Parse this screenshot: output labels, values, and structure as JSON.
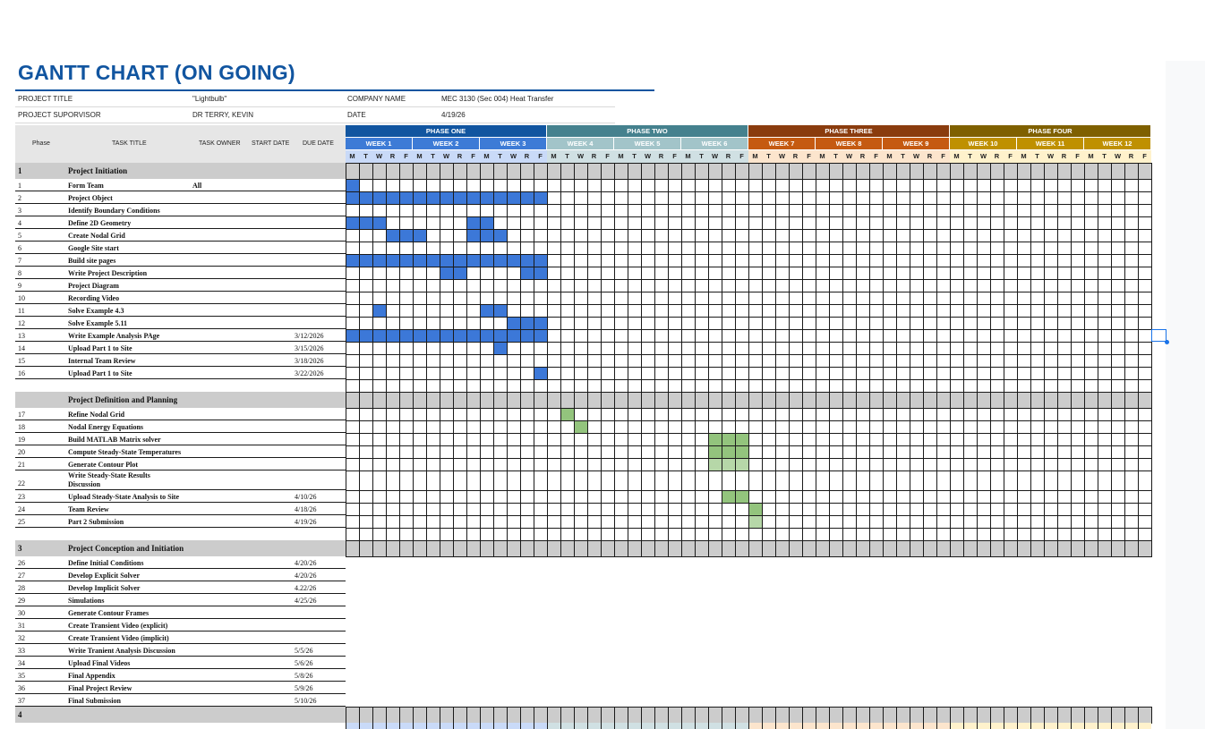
{
  "title": "GANTT CHART (ON GOING)",
  "info": {
    "project_title_label": "PROJECT TITLE",
    "project_title_value": "\"Lightbulb\"",
    "company_label": "COMPANY NAME",
    "company_value": "MEC 3130 (Sec 004) Heat Transfer",
    "supervisor_label": "PROJECT SUPORVISOR",
    "supervisor_value": "DR TERRY, KEVIN",
    "date_label": "DATE",
    "date_value": "4/19/26"
  },
  "columns": {
    "phase": "Phase",
    "task_title": "TASK TITLE",
    "task_owner": "TASK OWNER",
    "start_date": "START DATE",
    "due_date": "DUE DATE"
  },
  "phases": [
    {
      "name": "PHASE ONE",
      "color": "#1155a0",
      "light": "#c9daf8"
    },
    {
      "name": "PHASE TWO",
      "color": "#45818e",
      "light": "#d0e0e3"
    },
    {
      "name": "PHASE THREE",
      "color": "#8a3c0e",
      "light": "#fce5cd"
    },
    {
      "name": "PHASE FOUR",
      "color": "#7f6000",
      "light": "#fff2cc"
    }
  ],
  "weeks": [
    {
      "label": "WEEK 1",
      "color": "#3d7bd6"
    },
    {
      "label": "WEEK 2",
      "color": "#3d7bd6"
    },
    {
      "label": "WEEK 3",
      "color": "#3d7bd6"
    },
    {
      "label": "WEEK 4",
      "color": "#a2c4c9"
    },
    {
      "label": "WEEK 5",
      "color": "#a2c4c9"
    },
    {
      "label": "WEEK 6",
      "color": "#a2c4c9"
    },
    {
      "label": "WEEK 7",
      "color": "#c55a11"
    },
    {
      "label": "WEEK 8",
      "color": "#c55a11"
    },
    {
      "label": "WEEK 9",
      "color": "#c55a11"
    },
    {
      "label": "WEEK 10",
      "color": "#bf9000"
    },
    {
      "label": "WEEK 11",
      "color": "#bf9000"
    },
    {
      "label": "WEEK 12",
      "color": "#bf9000"
    }
  ],
  "day_letters": [
    "M",
    "T",
    "W",
    "R",
    "F"
  ],
  "fill_colors": {
    "blue": "#3c78d8",
    "green": "#93c47d",
    "ltgreen": "#b6d7a8"
  },
  "rows": [
    {
      "type": "section",
      "num": "1",
      "title": "Project Initiation"
    },
    {
      "type": "task",
      "num": "1",
      "title": "Form Team",
      "owner": "All",
      "start": "",
      "due": "",
      "fills": [
        [
          0,
          0,
          "blue"
        ]
      ]
    },
    {
      "type": "task",
      "num": "2",
      "title": "Project Object",
      "owner": "",
      "start": "",
      "due": "",
      "fills": [
        [
          0,
          14,
          "blue"
        ]
      ]
    },
    {
      "type": "task",
      "num": "3",
      "title": "Identify Boundary Conditions",
      "owner": "",
      "start": "",
      "due": "",
      "fills": []
    },
    {
      "type": "task",
      "num": "4",
      "title": "Define 2D Geometry",
      "owner": "",
      "start": "",
      "due": "",
      "fills": [
        [
          0,
          2,
          "blue"
        ],
        [
          9,
          10,
          "blue"
        ]
      ]
    },
    {
      "type": "task",
      "num": "5",
      "title": "Create Nodal Grid",
      "owner": "",
      "start": "",
      "due": "",
      "fills": [
        [
          3,
          5,
          "blue"
        ],
        [
          9,
          11,
          "blue"
        ]
      ]
    },
    {
      "type": "task",
      "num": "6",
      "title": "Google Site start",
      "owner": "",
      "start": "",
      "due": "",
      "fills": []
    },
    {
      "type": "task",
      "num": "7",
      "title": "Build site pages",
      "owner": "",
      "start": "",
      "due": "",
      "fills": [
        [
          0,
          14,
          "blue"
        ]
      ]
    },
    {
      "type": "task",
      "num": "8",
      "title": "Write Project Description",
      "owner": "",
      "start": "",
      "due": "",
      "fills": [
        [
          7,
          8,
          "blue"
        ],
        [
          13,
          14,
          "blue"
        ]
      ]
    },
    {
      "type": "task",
      "num": "9",
      "title": "Project Diagram",
      "owner": "",
      "start": "",
      "due": "",
      "fills": []
    },
    {
      "type": "task",
      "num": "10",
      "title": "Recording Video",
      "owner": "",
      "start": "",
      "due": "",
      "fills": []
    },
    {
      "type": "task",
      "num": "11",
      "title": "Solve Example 4.3",
      "owner": "",
      "start": "",
      "due": "",
      "fills": [
        [
          2,
          2,
          "blue"
        ],
        [
          10,
          11,
          "blue"
        ]
      ]
    },
    {
      "type": "task",
      "num": "12",
      "title": "Solve Example 5.11",
      "owner": "",
      "start": "",
      "due": "",
      "fills": [
        [
          12,
          14,
          "blue"
        ]
      ]
    },
    {
      "type": "task",
      "num": "13",
      "title": "Write Example Analysis PAge",
      "owner": "",
      "start": "",
      "due": "3/12/2026",
      "fills": [
        [
          0,
          14,
          "blue"
        ]
      ]
    },
    {
      "type": "task",
      "num": "14",
      "title": "Upload Part 1 to Site",
      "owner": "",
      "start": "",
      "due": "3/15/2026",
      "fills": [
        [
          11,
          11,
          "blue"
        ]
      ]
    },
    {
      "type": "task",
      "num": "15",
      "title": "Internal Team Review",
      "owner": "",
      "start": "",
      "due": "3/18/2026",
      "fills": []
    },
    {
      "type": "task",
      "num": "16",
      "title": "Upload Part 1 to Site",
      "owner": "",
      "start": "",
      "due": "3/22/2026",
      "fills": [
        [
          14,
          14,
          "blue"
        ]
      ]
    },
    {
      "type": "blank"
    },
    {
      "type": "section",
      "num": "",
      "title": "Project Definition and Planning"
    },
    {
      "type": "task",
      "num": "17",
      "title": "Refine Nodal Grid",
      "owner": "",
      "start": "",
      "due": "",
      "fills": [
        [
          16,
          16,
          "green"
        ]
      ]
    },
    {
      "type": "task",
      "num": "18",
      "title": "Nodal Energy Equations",
      "owner": "",
      "start": "",
      "due": "",
      "fills": [
        [
          17,
          17,
          "green"
        ]
      ]
    },
    {
      "type": "task",
      "num": "19",
      "title": "Build MATLAB Matrix solver",
      "owner": "",
      "start": "",
      "due": "",
      "fills": [
        [
          27,
          29,
          "green"
        ]
      ]
    },
    {
      "type": "task",
      "num": "20",
      "title": "Compute Steady-State Temperatures",
      "owner": "",
      "start": "",
      "due": "",
      "fills": [
        [
          27,
          29,
          "green"
        ]
      ]
    },
    {
      "type": "task",
      "num": "21",
      "title": "Generate Contour Plot",
      "owner": "",
      "start": "",
      "due": "",
      "fills": [
        [
          27,
          29,
          "ltgreen"
        ]
      ]
    },
    {
      "type": "task",
      "num": "22",
      "title": "Write Steady-State Results",
      "title2": "Discussion",
      "owner": "",
      "start": "",
      "due": "",
      "tall": true,
      "fills": []
    },
    {
      "type": "task",
      "num": "23",
      "title": "Upload Steady-State Analysis to Site",
      "owner": "",
      "start": "",
      "due": "4/10/26",
      "fills": [
        [
          28,
          29,
          "green"
        ]
      ]
    },
    {
      "type": "task",
      "num": "24",
      "title": "Team Review",
      "owner": "",
      "start": "",
      "due": "4/18/26",
      "fills": [
        [
          30,
          30,
          "green"
        ]
      ]
    },
    {
      "type": "task",
      "num": "25",
      "title": "Part 2 Submission",
      "owner": "",
      "start": "",
      "due": "4/19/26",
      "fills": [
        [
          30,
          30,
          "ltgreen"
        ]
      ]
    },
    {
      "type": "blank"
    },
    {
      "type": "section",
      "num": "3",
      "title": "Project Conception and Initiation"
    },
    {
      "type": "task",
      "num": "26",
      "title": "Define Initial Conditions",
      "owner": "",
      "start": "",
      "due": "4/20/26",
      "nogrid": true
    },
    {
      "type": "task",
      "num": "27",
      "title": "Develop Explicit Solver",
      "owner": "",
      "start": "",
      "due": "4/20/26",
      "nogrid": true
    },
    {
      "type": "task",
      "num": "28",
      "title": "Develop Implicit Solver",
      "owner": "",
      "start": "",
      "due": "4.22/26",
      "nogrid": true
    },
    {
      "type": "task",
      "num": "29",
      "title": "Simulations",
      "owner": "",
      "start": "",
      "due": "4/25/26",
      "nogrid": true
    },
    {
      "type": "task",
      "num": "30",
      "title": "Generate Contour Frames",
      "owner": "",
      "start": "",
      "due": "",
      "nogrid": true
    },
    {
      "type": "task",
      "num": "31",
      "title": "Create Transient Video (explicit)",
      "owner": "",
      "start": "",
      "due": "",
      "nogrid": true
    },
    {
      "type": "task",
      "num": "32",
      "title": "Create Transient Video (implicit)",
      "owner": "",
      "start": "",
      "due": "",
      "nogrid": true
    },
    {
      "type": "task",
      "num": "33",
      "title": "Write Tranient Analysis Discussion",
      "owner": "",
      "start": "",
      "due": "5/5/26",
      "nogrid": true
    },
    {
      "type": "task",
      "num": "34",
      "title": "Upload Final Videos",
      "owner": "",
      "start": "",
      "due": "5/6/26",
      "nogrid": true
    },
    {
      "type": "task",
      "num": "35",
      "title": "Final Appendix",
      "owner": "",
      "start": "",
      "due": "5/8/26",
      "nogrid": true
    },
    {
      "type": "task",
      "num": "36",
      "title": "Final Project Review",
      "owner": "",
      "start": "",
      "due": "5/9/26",
      "nogrid": true
    },
    {
      "type": "task",
      "num": "37",
      "title": "Final Submission",
      "owner": "",
      "start": "",
      "due": "5/10/26",
      "nogrid": true
    },
    {
      "type": "section",
      "num": "4",
      "title": ""
    }
  ]
}
